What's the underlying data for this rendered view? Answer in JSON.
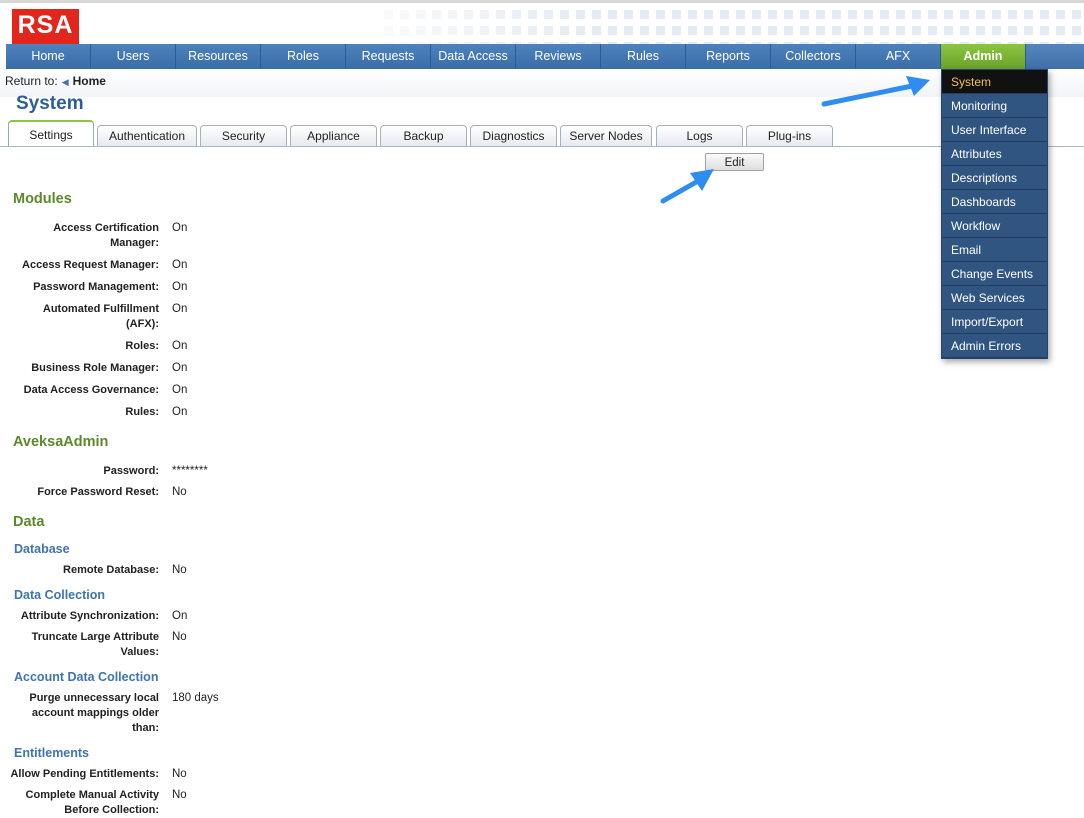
{
  "logo": "RSA",
  "nav": {
    "items": [
      "Home",
      "Users",
      "Resources",
      "Roles",
      "Requests",
      "Data Access",
      "Reviews",
      "Rules",
      "Reports",
      "Collectors",
      "AFX",
      "Admin"
    ]
  },
  "return_to": {
    "label": "Return to:",
    "link": "Home"
  },
  "page_title": "System",
  "tabs": [
    "Settings",
    "Authentication",
    "Security",
    "Appliance",
    "Backup",
    "Diagnostics",
    "Server Nodes",
    "Logs",
    "Plug-ins"
  ],
  "edit_label": "Edit",
  "admin_menu": [
    "System",
    "Monitoring",
    "User Interface",
    "Attributes",
    "Descriptions",
    "Dashboards",
    "Workflow",
    "Email",
    "Change Events",
    "Web Services",
    "Import/Export",
    "Admin Errors"
  ],
  "sections": {
    "modules": {
      "title": "Modules",
      "rows": [
        {
          "label": "Access Certification Manager:",
          "value": "On"
        },
        {
          "label": "Access Request Manager:",
          "value": "On"
        },
        {
          "label": "Password Management:",
          "value": "On"
        },
        {
          "label": "Automated Fulfillment (AFX):",
          "value": "On"
        },
        {
          "label": "Roles:",
          "value": "On"
        },
        {
          "label": "Business Role Manager:",
          "value": "On"
        },
        {
          "label": "Data Access Governance:",
          "value": "On"
        },
        {
          "label": "Rules:",
          "value": "On"
        }
      ]
    },
    "aveksa_admin": {
      "title": "AveksaAdmin",
      "rows": [
        {
          "label": "Password:",
          "value": "********"
        },
        {
          "label": "Force Password Reset:",
          "value": "No"
        }
      ]
    },
    "data": {
      "title": "Data",
      "database": {
        "title": "Database",
        "rows": [
          {
            "label": "Remote Database:",
            "value": "No"
          }
        ]
      },
      "data_collection": {
        "title": "Data Collection",
        "rows": [
          {
            "label": "Attribute Synchronization:",
            "value": "On"
          },
          {
            "label": "Truncate Large Attribute Values:",
            "value": "No"
          }
        ]
      },
      "account_data_collection": {
        "title": "Account Data Collection",
        "rows": [
          {
            "label": "Purge unnecessary local account mappings older than:",
            "value": "180 days"
          }
        ]
      },
      "entitlements": {
        "title": "Entitlements",
        "rows": [
          {
            "label": "Allow Pending Entitlements:",
            "value": "No"
          },
          {
            "label": "Complete Manual Activity Before Collection:",
            "value": "No"
          }
        ]
      }
    }
  }
}
